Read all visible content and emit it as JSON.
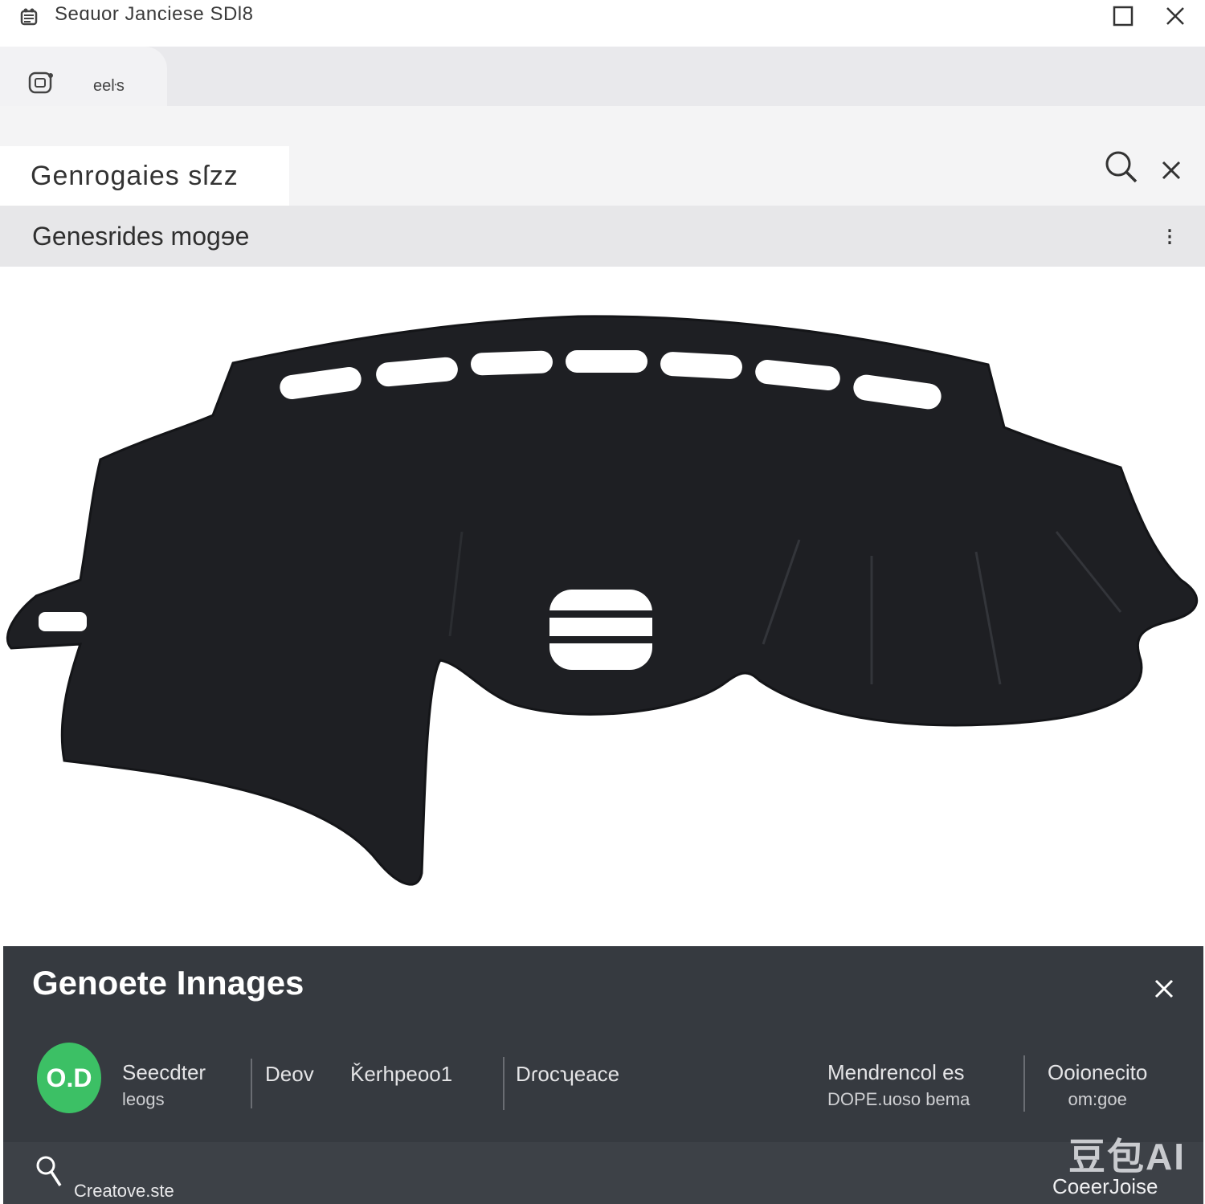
{
  "window": {
    "title": "Seɑuor Janciese SDl8",
    "icons": {
      "app": "app-icon",
      "maximize": "maximize-icon",
      "close": "close-icon"
    }
  },
  "tabs": [
    {
      "label": "eeŀs",
      "icon": "image-tab-icon"
    }
  ],
  "search": {
    "query": "Genrogaies sſzz",
    "search_icon": "search-icon",
    "clear_icon": "close-icon"
  },
  "section": {
    "title": "Genesrides mogɘe",
    "more_label": "⁝"
  },
  "viewer": {
    "subject": "black dashboard mat",
    "colors": {
      "mat": "#1e1f23",
      "cutout": "#ffffff",
      "background": "#ffffff"
    }
  },
  "panel": {
    "title": "Genoete Innages",
    "close_icon": "close-icon",
    "avatar": {
      "text": "O.D",
      "color": "#3cc065"
    },
    "options": [
      {
        "label": "Seecdter",
        "sub": "leogs"
      },
      {
        "label": "Deov",
        "sub": ""
      },
      {
        "label": "Ǩerhpeoo1",
        "sub": ""
      },
      {
        "label": "Dɾocʮeace",
        "sub": ""
      },
      {
        "label": "Mendrencol es",
        "sub": "DOPE.uoso bema"
      },
      {
        "label": "Ooionecito",
        "sub": "om:goe"
      }
    ],
    "bottom": {
      "search_icon": "search-icon",
      "label": "Creatove.ste",
      "right_label": "CoeerJoise",
      "watermark": "豆包AI"
    },
    "colors": {
      "background": "#363a40",
      "text": "#e4e4e6",
      "accent": "#3cc065"
    }
  }
}
